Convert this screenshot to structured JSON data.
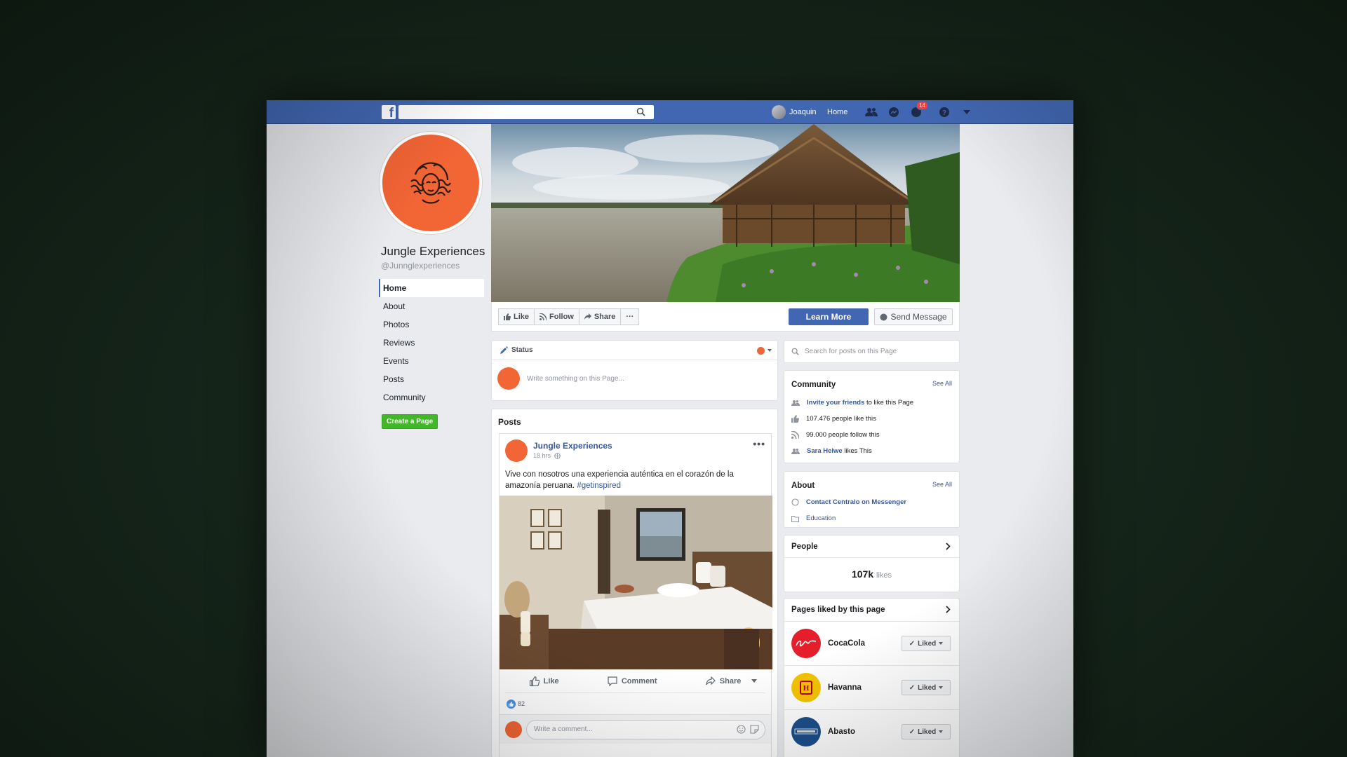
{
  "topbar": {
    "user_name": "Joaquin",
    "home_label": "Home",
    "notification_count": "14"
  },
  "page": {
    "name": "Jungle Experiences",
    "handle": "@Junnglexperiences"
  },
  "left_nav": {
    "items": [
      {
        "label": "Home",
        "active": true
      },
      {
        "label": "About"
      },
      {
        "label": "Photos"
      },
      {
        "label": "Reviews"
      },
      {
        "label": "Events"
      },
      {
        "label": "Posts"
      },
      {
        "label": "Community"
      }
    ],
    "create_page": "Create a Page"
  },
  "action_bar": {
    "like": "Like",
    "follow": "Follow",
    "share": "Share",
    "more": "···",
    "learn_more": "Learn More",
    "send_message": "Send Message"
  },
  "composer": {
    "status_label": "Status",
    "placeholder": "Write something on this Page..."
  },
  "posts": {
    "title": "Posts",
    "post": {
      "author": "Jungle Experiences",
      "time": "18 hrs",
      "text": "Vive con nosotros una experiencia auténtica en el corazón de la amazonía peruana.",
      "hashtag": "#getinspired",
      "actions": {
        "like": "Like",
        "comment": "Comment",
        "share": "Share"
      },
      "like_count": "82",
      "comment_placeholder": "Write a comment..."
    }
  },
  "right": {
    "search_placeholder": "Search for posts on this Page",
    "community": {
      "title": "Community",
      "see_all": "See All",
      "invite_link": "Invite your friends",
      "invite_rest": "to like this Page",
      "likes": "107.476 people like this",
      "follows": "99.000 people follow this",
      "friend_name": "Sara Helwe",
      "friend_rest": "likes This"
    },
    "about": {
      "title": "About",
      "see_all": "See All",
      "messenger": "Contact Centralo on Messenger",
      "category": "Education"
    },
    "people": {
      "title": "People",
      "count": "107k",
      "count_label": "likes"
    },
    "pages_liked": {
      "title": "Pages liked by this page",
      "items": [
        {
          "name": "CocaCola",
          "button": "Liked",
          "color": "#e41e2b"
        },
        {
          "name": "Havanna",
          "button": "Liked",
          "color": "#f5c400"
        },
        {
          "name": "Abasto",
          "button": "Liked",
          "color": "#1c4f8a"
        }
      ]
    }
  },
  "colors": {
    "facebook_blue": "#4267b2",
    "brand_orange": "#f26535",
    "green_button": "#42b72a",
    "link_blue": "#385898"
  }
}
